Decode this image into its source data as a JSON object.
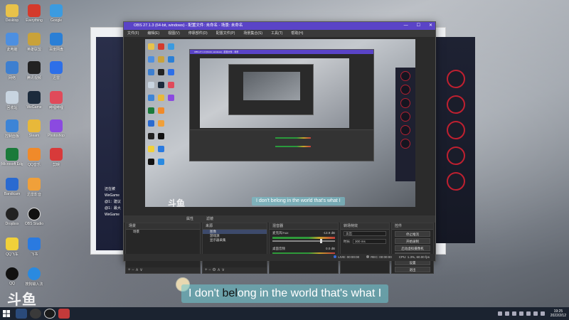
{
  "desktop": {
    "icons": [
      {
        "label": "Desktop"
      },
      {
        "label": "Everything"
      },
      {
        "label": "Google"
      },
      {
        "label": "此电脑"
      },
      {
        "label": "英雄联盟"
      },
      {
        "label": "百度网盘"
      },
      {
        "label": "网络"
      },
      {
        "label": "腾讯视频"
      },
      {
        "label": "迅雷"
      },
      {
        "label": "回收站"
      },
      {
        "label": "WeGame"
      },
      {
        "label": "哔哩哔哩"
      },
      {
        "label": "控制面板"
      },
      {
        "label": "Steam"
      },
      {
        "label": "Photoshop"
      },
      {
        "label": "Microsoft Edge"
      },
      {
        "label": "QQ音乐"
      },
      {
        "label": "剪映"
      },
      {
        "label": "Bandicam"
      },
      {
        "label": "迅雷影音"
      },
      {
        "label": "网易云音乐"
      },
      {
        "label": "360安全"
      },
      {
        "label": "斗鱼直播"
      },
      {
        "label": ""
      },
      {
        "label": "Dropbox"
      },
      {
        "label": "OBS Studio"
      },
      {
        "label": ""
      },
      {
        "label": "QQ飞车"
      },
      {
        "label": "飞书"
      },
      {
        "label": ""
      },
      {
        "label": "QQ"
      },
      {
        "label": "搜狗输入法"
      },
      {
        "label": ""
      }
    ]
  },
  "bg_chat": {
    "lines": [
      "还在被",
      "WeGame",
      "@1：建议",
      "@1：最大",
      "WeGame"
    ]
  },
  "obs": {
    "title": "OBS 27.1.3 (64-bit, windows) - 配置文件: 未命名 - 场景: 未命名",
    "menu": [
      "文件(F)",
      "编辑(E)",
      "视图(V)",
      "停靠部件(D)",
      "配置文件(P)",
      "场景集合(S)",
      "工具(T)",
      "帮助(H)"
    ],
    "win_controls": {
      "min": "—",
      "max": "☐",
      "close": "✕"
    },
    "nested_title": "OBS 27.1.3 (64-bit, windows) - 配置文件 - 场景",
    "preview_subtitle": "I don't belong in the world that's what I",
    "preview_logo": "斗鱼",
    "toolbar": {
      "props": "属性",
      "filters": "滤镜"
    },
    "scenes": {
      "header": "来源",
      "title": "场景",
      "items": [
        "场景"
      ],
      "footer": "+ −  ∧  ∨"
    },
    "sources": {
      "header": "来源",
      "items": [
        "图像",
        "游戏源",
        "显示器采集"
      ],
      "footer": "+ −  ⚙  ∧  ∨"
    },
    "mixer": {
      "header": "混音器",
      "channels": [
        {
          "name": "麦克风/Aux",
          "db": "-13.9 dB"
        },
        {
          "name": "桌面音频",
          "db": "0.0 dB"
        }
      ]
    },
    "transitions": {
      "header": "转场特效",
      "type": "淡出",
      "duration_label": "时长",
      "duration": "300 ms"
    },
    "controls": {
      "header": "控件",
      "buttons": [
        "停止推流",
        "开始录制",
        "启动虚拟摄像机",
        "工作室模式",
        "设置",
        "退出"
      ]
    },
    "status": {
      "live": "LIVE: 00:00:00",
      "rec": "REC: 00:00:00",
      "cpu": "CPU: 1.3%, 60.00 fps"
    }
  },
  "overlay": {
    "subtitle_part1": "I don't ",
    "subtitle_part2": "bel",
    "subtitle_part3": "ong in the world that's what I",
    "logo": "斗鱼"
  },
  "taskbar": {
    "clock_time": "19:25",
    "clock_date": "2022/2/12"
  },
  "colors": {
    "obs_title_bar": "#5a44c7",
    "obs_dark": "#2b2b2b",
    "meter_green": "#2f9a3a",
    "meter_red": "#c23a3a",
    "subtitle_bg": "#6cc8d2",
    "taskbar": "#1b2330"
  }
}
